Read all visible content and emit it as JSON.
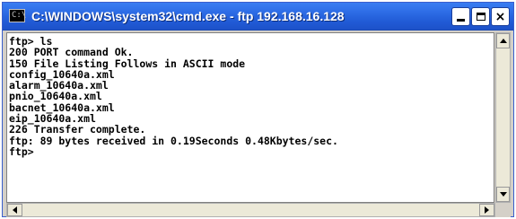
{
  "window": {
    "title": "C:\\WINDOWS\\system32\\cmd.exe - ftp 192.168.16.128",
    "icon_text": "C:\\",
    "icon_name": "cmd-icon"
  },
  "caption_buttons": {
    "minimize": "minimize-icon",
    "maximize": "maximize-icon",
    "close_glyph": "×"
  },
  "console": {
    "lines": [
      "ftp> ls",
      "200 PORT command Ok.",
      "150 File Listing Follows in ASCII mode",
      "config_10640a.xml",
      "alarm_10640a.xml",
      "pnio_10640a.xml",
      "bacnet_10640a.xml",
      "eip_10640a.xml",
      "226 Transfer complete.",
      "ftp: 89 bytes received in 0.19Seconds 0.48Kbytes/sec.",
      "ftp>"
    ]
  },
  "colors": {
    "title_bar": "#215bd6",
    "console_bg": "#ffffff",
    "console_text": "#000000"
  }
}
